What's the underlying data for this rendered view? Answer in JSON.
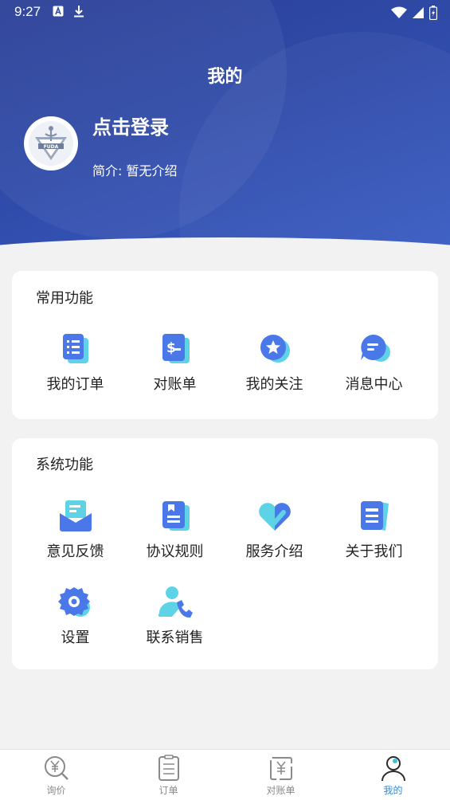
{
  "status_bar": {
    "time": "9:27"
  },
  "header": {
    "title": "我的"
  },
  "profile": {
    "login_label": "点击登录",
    "intro_label": "简介:",
    "intro_value": "暂无介绍",
    "logo_text": "FUDA"
  },
  "common_section": {
    "title": "常用功能",
    "items": [
      {
        "label": "我的订单",
        "icon": "order-list-icon"
      },
      {
        "label": "对账单",
        "icon": "statement-icon"
      },
      {
        "label": "我的关注",
        "icon": "favorite-icon"
      },
      {
        "label": "消息中心",
        "icon": "message-icon"
      }
    ]
  },
  "system_section": {
    "title": "系统功能",
    "items": [
      {
        "label": "意见反馈",
        "icon": "feedback-icon"
      },
      {
        "label": "协议规则",
        "icon": "agreement-icon"
      },
      {
        "label": "服务介绍",
        "icon": "service-icon"
      },
      {
        "label": "关于我们",
        "icon": "about-icon"
      },
      {
        "label": "设置",
        "icon": "settings-icon"
      },
      {
        "label": "联系销售",
        "icon": "contact-sales-icon"
      }
    ]
  },
  "tabbar": {
    "items": [
      {
        "label": "询价",
        "icon": "inquiry-icon",
        "active": false
      },
      {
        "label": "订单",
        "icon": "order-icon",
        "active": false
      },
      {
        "label": "对账单",
        "icon": "statement-tab-icon",
        "active": false
      },
      {
        "label": "我的",
        "icon": "profile-icon",
        "active": true
      }
    ]
  },
  "colors": {
    "header_bg": "#2f4aa8",
    "icon_primary": "#4a78e8",
    "icon_secondary": "#5fd3e6",
    "active_tab": "#2e8bd9"
  }
}
